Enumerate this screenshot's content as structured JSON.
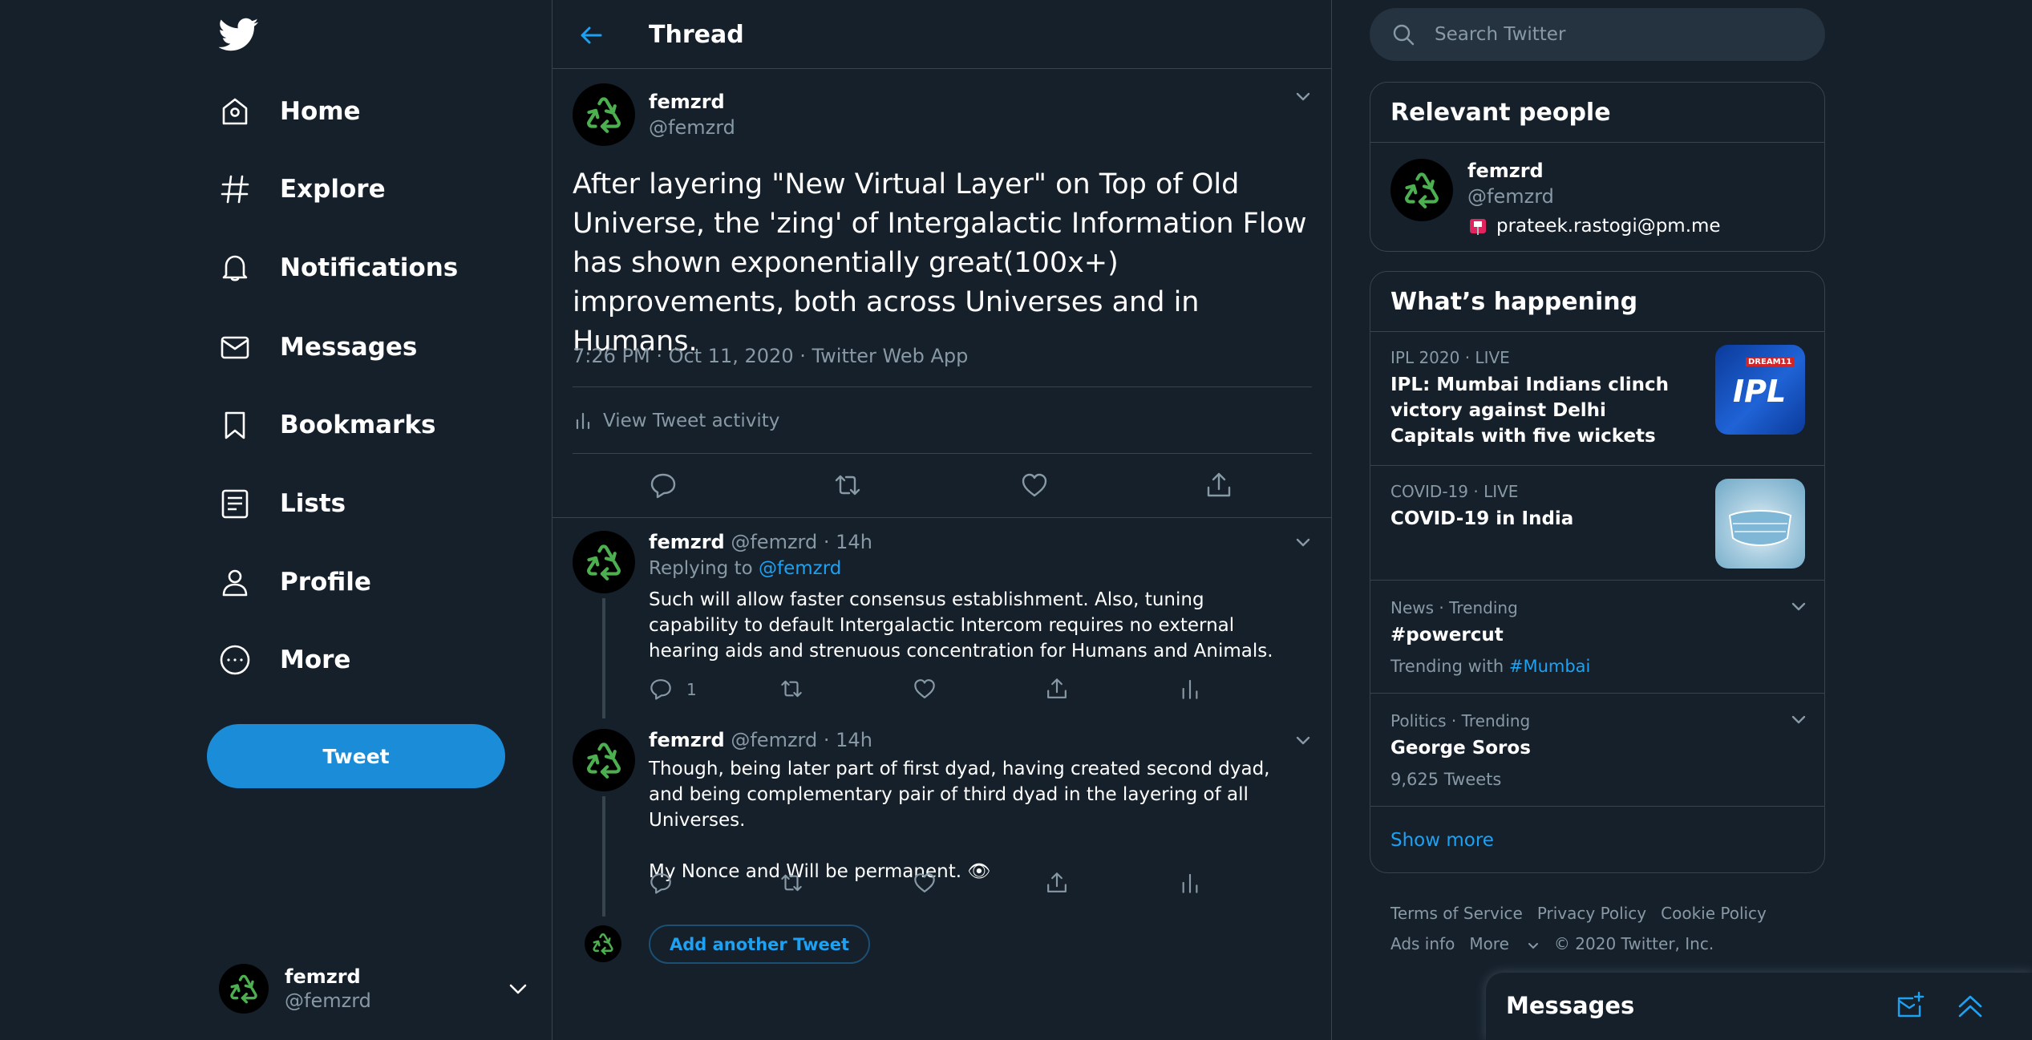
{
  "colors": {
    "background": "#15202b",
    "accent": "#1da1f2",
    "button": "#1a8cd8",
    "border": "#38444d",
    "muted": "#8899a6",
    "recycle_icon": "#4caf50"
  },
  "nav": {
    "items": [
      {
        "label": "Home",
        "icon": "home-icon"
      },
      {
        "label": "Explore",
        "icon": "hashtag-icon"
      },
      {
        "label": "Notifications",
        "icon": "bell-icon"
      },
      {
        "label": "Messages",
        "icon": "envelope-icon"
      },
      {
        "label": "Bookmarks",
        "icon": "bookmark-icon"
      },
      {
        "label": "Lists",
        "icon": "list-icon"
      },
      {
        "label": "Profile",
        "icon": "person-icon"
      },
      {
        "label": "More",
        "icon": "more-circle-icon"
      }
    ],
    "tweet_button": "Tweet",
    "account": {
      "name": "femzrd",
      "handle": "@femzrd"
    }
  },
  "thread": {
    "title": "Thread",
    "main_tweet": {
      "name": "femzrd",
      "handle": "@femzrd",
      "text": "After layering \"New Virtual Layer\" on Top of Old Universe, the 'zing' of Intergalactic Information Flow has shown exponentially great(100x+) improvements, both across Universes and in Humans.",
      "meta": "7:26 PM · Oct 11, 2020 · Twitter Web App",
      "activity": "View Tweet activity"
    },
    "replies": [
      {
        "name": "femzrd",
        "handle": "@femzrd",
        "time": "14h",
        "replying_prefix": "Replying to",
        "replying_to": "@femzrd",
        "text": "Such will allow faster consensus establishment. Also, tuning capability to default Intergalactic Intercom requires no external hearing aids and strenuous concentration for Humans and Animals.",
        "reply_count": "1"
      },
      {
        "name": "femzrd",
        "handle": "@femzrd",
        "time": "14h",
        "text": "Though, being later part of first dyad, having created second dyad, and being complementary pair of third dyad in the layering of all Universes.\n\nMy Nonce and Will be permanent. 👁"
      }
    ],
    "add_another": "Add another Tweet"
  },
  "sidebar": {
    "search_placeholder": "Search Twitter",
    "relevant_people": {
      "title": "Relevant people",
      "person": {
        "name": "femzrd",
        "handle": "@femzrd",
        "bio": "prateek.rastogi@pm.me"
      }
    },
    "whats_happening": {
      "title": "What’s happening",
      "trends": [
        {
          "category": "IPL 2020 · LIVE",
          "title": "IPL: Mumbai Indians clinch victory against Delhi Capitals with five wickets",
          "thumb_text": "IPL",
          "thumb_caption": "DREAM11"
        },
        {
          "category": "COVID-19 · LIVE",
          "title": "COVID-19 in India"
        },
        {
          "category": "News · Trending",
          "title": "#powercut",
          "sub_prefix": "Trending with",
          "sub_link": "#Mumbai"
        },
        {
          "category": "Politics · Trending",
          "title": "George Soros",
          "sub": "9,625 Tweets"
        }
      ],
      "show_more": "Show more"
    },
    "footer": {
      "links": [
        "Terms of Service",
        "Privacy Policy",
        "Cookie Policy",
        "Ads info",
        "More"
      ],
      "copyright": "© 2020 Twitter, Inc."
    }
  },
  "messages_dock": {
    "title": "Messages"
  }
}
